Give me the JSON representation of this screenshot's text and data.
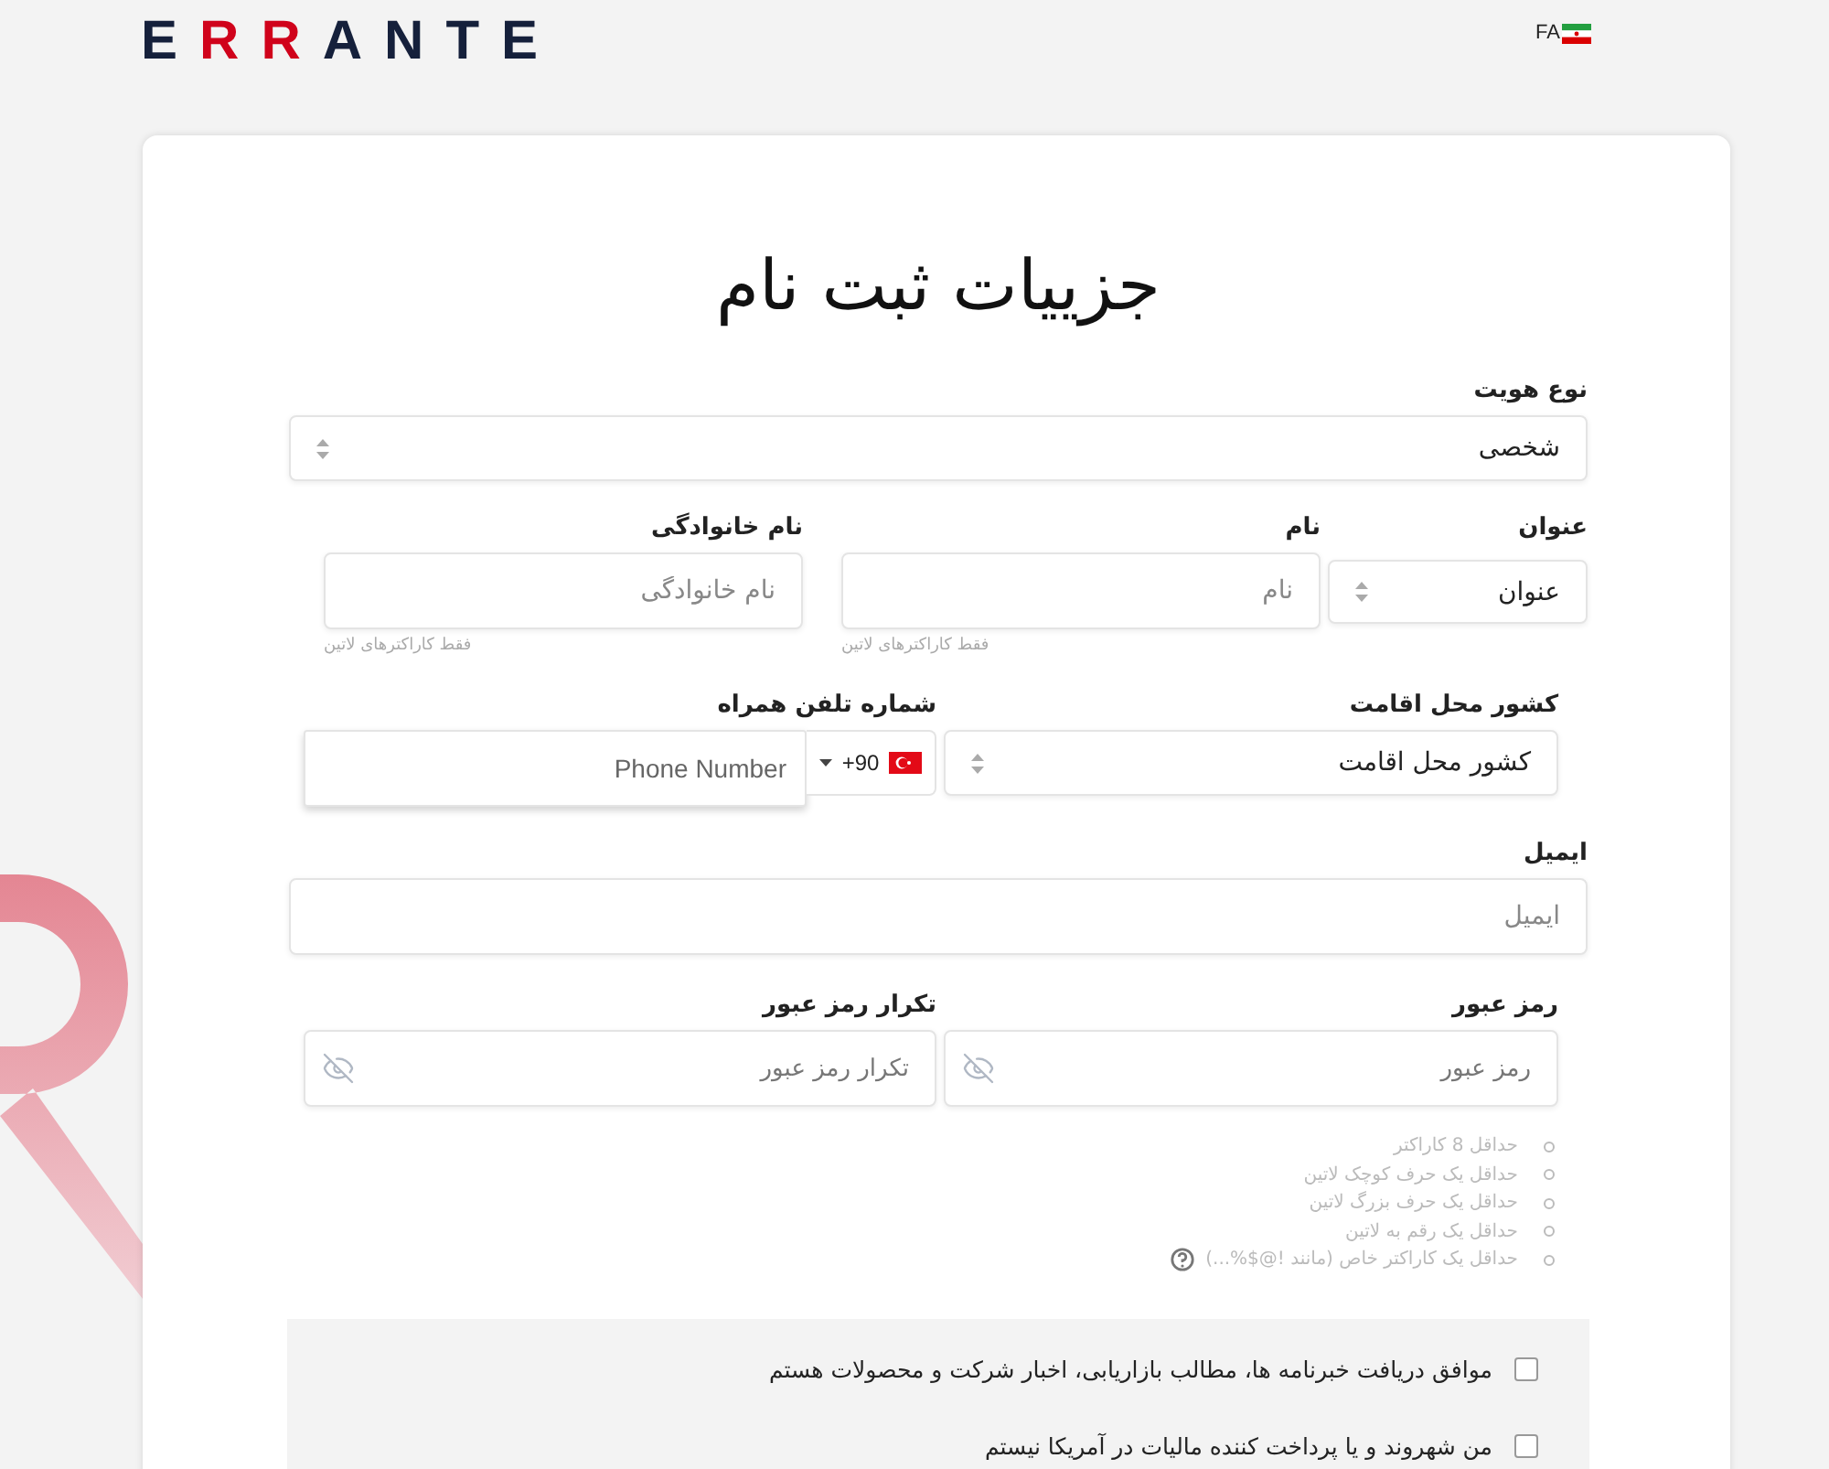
{
  "header": {
    "logo": "ERRANTE",
    "language": "FA"
  },
  "form": {
    "title": "جزییات ثبت نام",
    "identity_type": {
      "label": "نوع هویت",
      "value": "شخصی"
    },
    "salutation": {
      "label": "عنوان",
      "value": "عنوان"
    },
    "first_name": {
      "label": "نام",
      "placeholder": "نام",
      "hint": "فقط کاراکترهای لاتین"
    },
    "last_name": {
      "label": "نام خانوادگی",
      "placeholder": "نام خانوادگی",
      "hint": "فقط کاراکترهای لاتین"
    },
    "country": {
      "label": "کشور محل اقامت",
      "value": "کشور محل اقامت"
    },
    "phone": {
      "label": "شماره تلفن همراه",
      "dial_code": "+90",
      "placeholder": "Phone Number"
    },
    "email": {
      "label": "ایمیل",
      "placeholder": "ایمیل"
    },
    "password": {
      "label": "رمز عبور",
      "placeholder": "رمز عبور"
    },
    "confirm_password": {
      "label": "تکرار رمز عبور",
      "placeholder": "تکرار رمز عبور"
    },
    "password_rules": [
      {
        "text": "حداقل 8 کاراکتر",
        "help": false
      },
      {
        "text": "حداقل یک حرف کوچک لاتین",
        "help": false
      },
      {
        "text": "حداقل یک حرف بزرگ لاتین",
        "help": false
      },
      {
        "text": "حداقل یک رقم به لاتین",
        "help": false
      },
      {
        "text": "حداقل یک کاراکتر خاص (مانند !@$%...)",
        "help": true
      }
    ],
    "consents": [
      {
        "text": "موافق دریافت خبرنامه ها، مطالب بازاریابی، اخبار شرکت و محصولات هستم",
        "checked": false
      },
      {
        "text": "من شهروند و یا پرداخت کننده مالیات در آمریکا نیستم",
        "checked": false
      }
    ]
  }
}
